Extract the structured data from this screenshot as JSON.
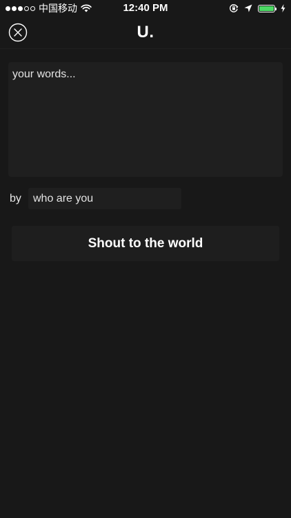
{
  "status_bar": {
    "carrier": "中国移动",
    "time": "12:40 PM",
    "signal_strength": 3,
    "signal_max": 5,
    "battery_color": "#4cd964",
    "battery_level": 1.0,
    "icons": [
      "wifi-icon",
      "orientation-lock-icon",
      "location-arrow-icon",
      "battery-icon",
      "charging-bolt-icon"
    ]
  },
  "nav": {
    "close_icon": "close-circle-icon",
    "logo": "U."
  },
  "compose": {
    "words_placeholder": "your words...",
    "words_value": "",
    "by_label": "by",
    "name_placeholder": "who are you",
    "name_value": "",
    "submit_label": "Shout to the world"
  },
  "colors": {
    "background": "#181818",
    "field_background": "#1f1f1f",
    "text": "#ffffff"
  }
}
